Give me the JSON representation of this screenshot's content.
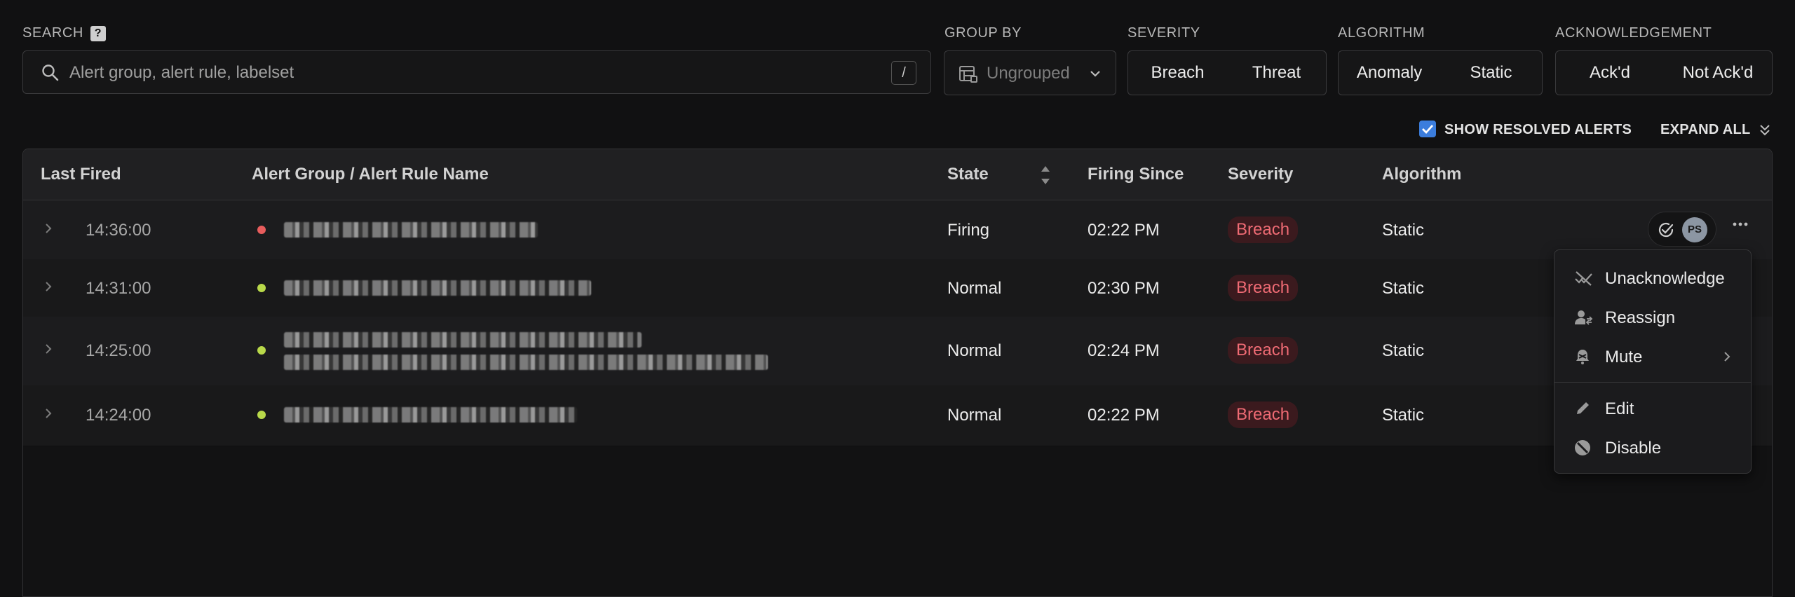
{
  "filters": {
    "search_label": "SEARCH",
    "help_badge": "?",
    "search_placeholder": "Alert group, alert rule, labelset",
    "search_shortcut": "/",
    "group_by_label": "GROUP BY",
    "group_by_value": "Ungrouped",
    "severity_label": "SEVERITY",
    "severity_options": [
      "Breach",
      "Threat"
    ],
    "algorithm_label": "ALGORITHM",
    "algorithm_options": [
      "Anomaly",
      "Static"
    ],
    "ack_label": "ACKNOWLEDGEMENT",
    "ack_options": [
      "Ack'd",
      "Not Ack'd"
    ]
  },
  "options": {
    "show_resolved_label": "SHOW RESOLVED ALERTS",
    "show_resolved_checked": true,
    "expand_all_label": "EXPAND ALL"
  },
  "table": {
    "columns": [
      "Last Fired",
      "Alert Group / Alert Rule Name",
      "State",
      "Firing Since",
      "Severity",
      "Algorithm"
    ],
    "rows": [
      {
        "last_fired": "14:36:00",
        "state": "Firing",
        "firing_since": "02:22 PM",
        "severity": "Breach",
        "algorithm": "Static",
        "status_color": "#e85d5d"
      },
      {
        "last_fired": "14:31:00",
        "state": "Normal",
        "firing_since": "02:30 PM",
        "severity": "Breach",
        "algorithm": "Static",
        "status_color": "#b9d94a"
      },
      {
        "last_fired": "14:25:00",
        "state": "Normal",
        "firing_since": "02:24 PM",
        "severity": "Breach",
        "algorithm": "Static",
        "status_color": "#b9d94a"
      },
      {
        "last_fired": "14:24:00",
        "state": "Normal",
        "firing_since": "02:22 PM",
        "severity": "Breach",
        "algorithm": "Static",
        "status_color": "#b9d94a"
      }
    ]
  },
  "row_actions": {
    "avatar_initials": "PS"
  },
  "context_menu": {
    "items": [
      "Unacknowledge",
      "Reassign",
      "Mute",
      "Edit",
      "Disable"
    ]
  },
  "colors": {
    "background": "#111112",
    "accent": "#3b7ddd",
    "breach_text": "#ef6b74",
    "breach_bg": "#3b1a1e"
  }
}
